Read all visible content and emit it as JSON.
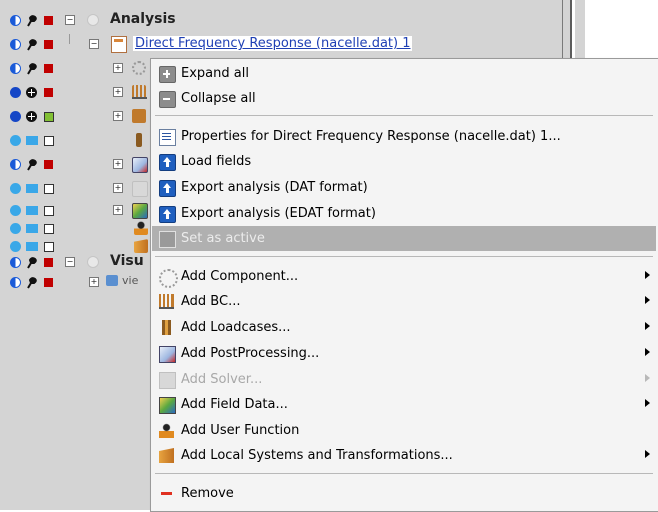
{
  "tree": {
    "section_analysis": "Analysis",
    "selected_item": "Direct Frequency Response (nacelle.dat) 1",
    "section_visu": "Visu",
    "visu_child": "vie"
  },
  "colors": {
    "menu_bg": "#f4f4f4",
    "highlight_bg": "#b0b0b0",
    "selected_text": "#1e3fb4",
    "panel_bg": "#d4d4d4"
  },
  "context_menu": {
    "items": [
      {
        "label": "Expand all",
        "icon": "expand-icon"
      },
      {
        "label": "Collapse all",
        "icon": "collapse-icon"
      },
      {
        "label": "Properties for Direct Frequency Response (nacelle.dat) 1...",
        "icon": "properties-icon"
      },
      {
        "label": "Load fields",
        "icon": "load-fields-icon"
      },
      {
        "label": "Export analysis (DAT format)",
        "icon": "export-dat-icon"
      },
      {
        "label": "Export analysis (EDAT format)",
        "icon": "export-edat-icon"
      },
      {
        "label": "Set as active",
        "icon": "set-active-icon",
        "disabled": true,
        "highlighted": true
      },
      {
        "label": "Add Component...",
        "icon": "gear-icon",
        "submenu": true
      },
      {
        "label": "Add BC...",
        "icon": "bc-icon",
        "submenu": true
      },
      {
        "label": "Add Loadcases...",
        "icon": "loadcases-icon",
        "submenu": true
      },
      {
        "label": "Add PostProcessing...",
        "icon": "postprocessing-icon",
        "submenu": true
      },
      {
        "label": "Add Solver...",
        "icon": "solver-icon",
        "submenu": true,
        "disabled": true
      },
      {
        "label": "Add Field Data...",
        "icon": "field-data-icon",
        "submenu": true
      },
      {
        "label": "Add User Function",
        "icon": "user-function-icon"
      },
      {
        "label": "Add Local Systems and Transformations...",
        "icon": "local-systems-icon",
        "submenu": true
      },
      {
        "label": "Remove",
        "icon": "remove-icon"
      }
    ]
  }
}
